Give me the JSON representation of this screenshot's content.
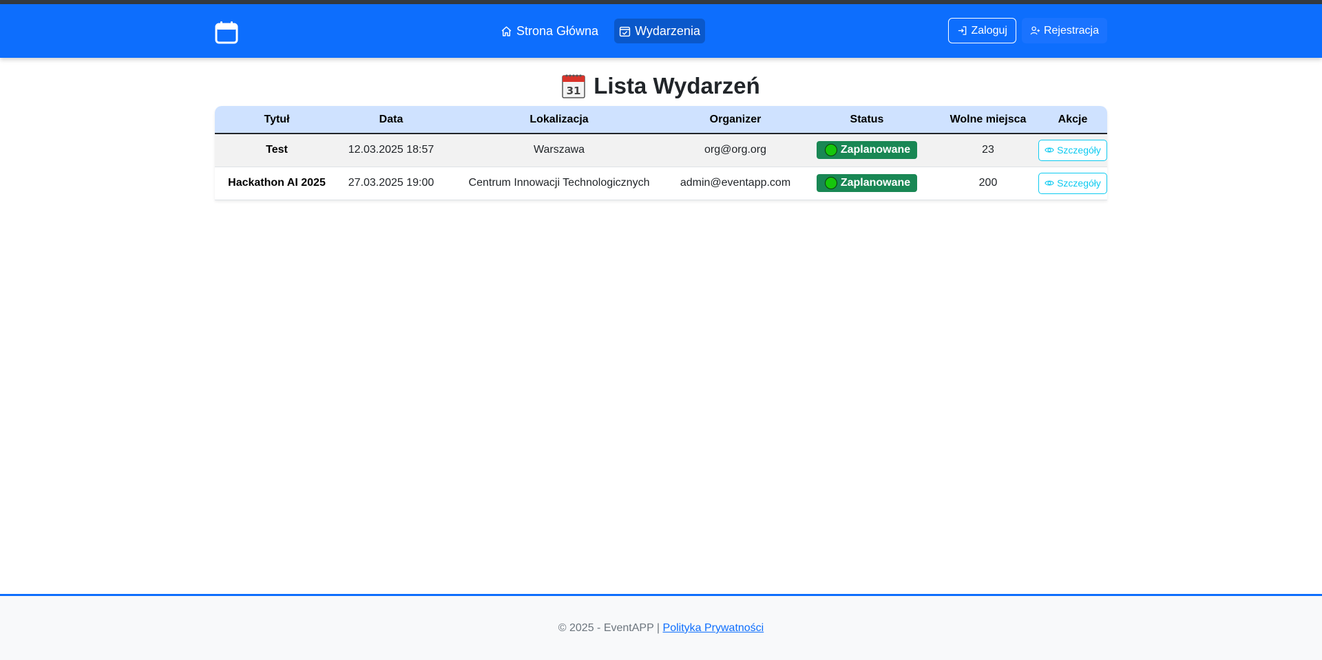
{
  "navbar": {
    "brand_icon": "calendar-icon",
    "links": [
      {
        "label": "Strona Główna",
        "icon": "house-icon",
        "active": false
      },
      {
        "label": "Wydarzenia",
        "icon": "calendar-check-icon",
        "active": true
      }
    ],
    "login_label": "Zaloguj",
    "register_label": "Rejestracja"
  },
  "page": {
    "title": "Lista Wydarzeń"
  },
  "table": {
    "columns": [
      "Tytuł",
      "Data",
      "Lokalizacja",
      "Organizer",
      "Status",
      "Wolne miejsca",
      "Akcje"
    ],
    "rows": [
      {
        "title": "Test",
        "date": "12.03.2025 18:57",
        "location": "Warszawa",
        "organizer": "org@org.org",
        "status": "Zaplanowane",
        "seats": "23",
        "action": "Szczegóły"
      },
      {
        "title": "Hackathon AI 2025",
        "date": "27.03.2025 19:00",
        "location": "Centrum Innowacji Technologicznych",
        "organizer": "admin@eventapp.com",
        "status": "Zaplanowane",
        "seats": "200",
        "action": "Szczegóły"
      }
    ]
  },
  "footer": {
    "copyright": "© 2025 - EventAPP |",
    "privacy_link": "Polityka Prywatności"
  },
  "colors": {
    "primary": "#0d6efd",
    "header_row": "#cfe2ff",
    "status_badge": "#198754",
    "details_button": "#0dcaf0"
  }
}
